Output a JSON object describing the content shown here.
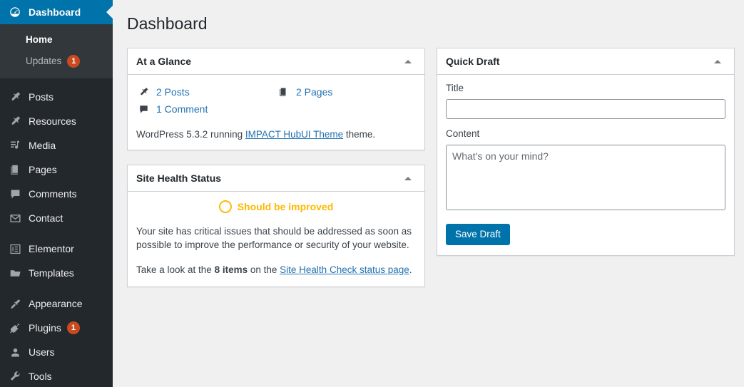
{
  "sidebar": {
    "top_item": {
      "label": "Dashboard",
      "icon": "dashboard-icon",
      "active_color": "#0073aa"
    },
    "submenu": [
      {
        "label": "Home",
        "current": true
      },
      {
        "label": "Updates",
        "current": false,
        "badge": "1"
      }
    ],
    "groups": [
      [
        {
          "label": "Posts",
          "icon": "pin-icon"
        },
        {
          "label": "Resources",
          "icon": "pin-icon"
        },
        {
          "label": "Media",
          "icon": "media-icon"
        },
        {
          "label": "Pages",
          "icon": "pages-icon"
        },
        {
          "label": "Comments",
          "icon": "comment-icon"
        },
        {
          "label": "Contact",
          "icon": "envelope-icon"
        }
      ],
      [
        {
          "label": "Elementor",
          "icon": "elementor-icon"
        },
        {
          "label": "Templates",
          "icon": "folder-icon"
        }
      ],
      [
        {
          "label": "Appearance",
          "icon": "paintbrush-icon"
        },
        {
          "label": "Plugins",
          "icon": "plug-icon",
          "badge": "1"
        },
        {
          "label": "Users",
          "icon": "user-icon"
        },
        {
          "label": "Tools",
          "icon": "wrench-icon"
        }
      ]
    ],
    "badge_color": "#ca4a1f"
  },
  "page": {
    "title": "Dashboard"
  },
  "at_a_glance": {
    "title": "At a Glance",
    "toggle_icon": "chevron-up-icon",
    "items": [
      {
        "label": "2 Posts",
        "icon": "pin-icon"
      },
      {
        "label": "2 Pages",
        "icon": "pages-icon"
      },
      {
        "label": "1 Comment",
        "icon": "comment-icon"
      }
    ],
    "version_prefix": "WordPress 5.3.2 running ",
    "theme_link": "IMPACT HubUI Theme",
    "version_suffix": " theme."
  },
  "site_health": {
    "title": "Site Health Status",
    "toggle_icon": "chevron-up-icon",
    "status_label": "Should be improved",
    "status_color": "#ffb900",
    "description": "Your site has critical issues that should be addressed as soon as possible to improve the performance or security of your website.",
    "cta_prefix": "Take a look at the ",
    "cta_count": "8 items",
    "cta_middle": " on the ",
    "cta_link": "Site Health Check status page",
    "cta_suffix": "."
  },
  "quick_draft": {
    "title": "Quick Draft",
    "toggle_icon": "chevron-up-icon",
    "title_label": "Title",
    "title_value": "",
    "title_placeholder": "",
    "content_label": "Content",
    "content_value": "",
    "content_placeholder": "What's on your mind?",
    "save_label": "Save Draft",
    "button_color": "#0073aa"
  }
}
